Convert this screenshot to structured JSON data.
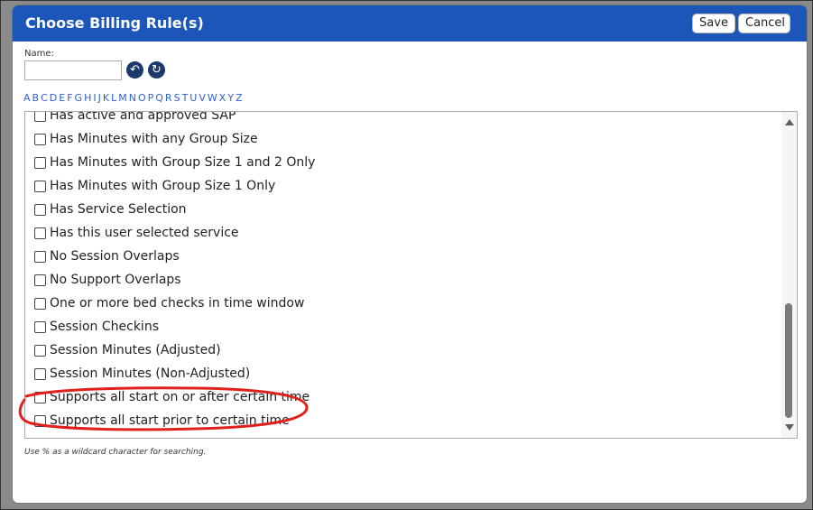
{
  "dialog": {
    "title": "Choose Billing Rule(s)",
    "save_label": "Save",
    "cancel_label": "Cancel"
  },
  "search": {
    "name_label": "Name:",
    "name_value": "",
    "undo_icon": "undo-icon",
    "refresh_icon": "refresh-icon"
  },
  "alphabet": [
    "A",
    "B",
    "C",
    "D",
    "E",
    "F",
    "G",
    "H",
    "I",
    "J",
    "K",
    "L",
    "M",
    "N",
    "O",
    "P",
    "Q",
    "R",
    "S",
    "T",
    "U",
    "V",
    "W",
    "X",
    "Y",
    "Z"
  ],
  "rules": [
    "Has active and approved SAP",
    "Has Minutes with any Group Size",
    "Has Minutes with Group Size 1 and 2 Only",
    "Has Minutes with Group Size 1 Only",
    "Has Service Selection",
    "Has this user selected service",
    "No Session Overlaps",
    "No Support Overlaps",
    "One or more bed checks in time window",
    "Session Checkins",
    "Session Minutes (Adjusted)",
    "Session Minutes (Non-Adjusted)",
    "Supports all start on or after certain time",
    "Supports all start prior to certain time"
  ],
  "hint": "Use % as a wildcard character for searching.",
  "colors": {
    "titlebar": "#1b56b8",
    "link": "#3060d8",
    "annotation": "#e0201b"
  }
}
